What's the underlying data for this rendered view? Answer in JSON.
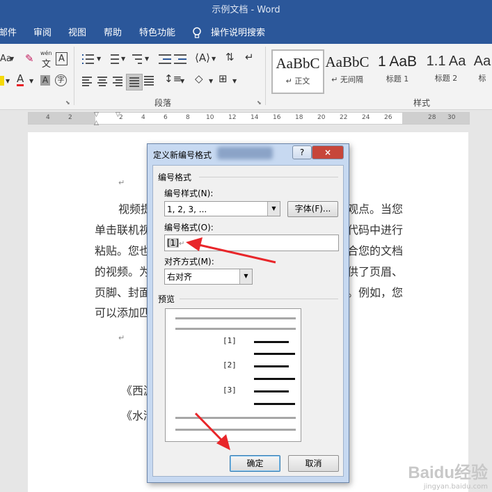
{
  "window": {
    "title": "示例文档 - Word"
  },
  "menubar": {
    "items": [
      "邮件",
      "审阅",
      "视图",
      "帮助",
      "特色功能"
    ],
    "tell_me": "操作说明搜索"
  },
  "ribbon": {
    "group_paragraph": "段落",
    "group_styles": "样式",
    "font_aa": "Aa",
    "phonetic_top": "wén",
    "phonetic_bottom": "文",
    "boxed_a": "A",
    "char_a": "A",
    "shaded_a": "A",
    "enclosed_char": "字",
    "styles": [
      {
        "sample": "AaBbC",
        "name": "↵ 正文"
      },
      {
        "sample": "AaBbC",
        "name": "↵ 无间隔"
      },
      {
        "sample": "1 AaB",
        "name": "标题 1"
      },
      {
        "sample": "1.1 Aa",
        "name": "标题 2"
      },
      {
        "sample": "Aa",
        "name": "标"
      }
    ]
  },
  "ruler": {
    "marks": [
      "4",
      "2",
      "2",
      "4",
      "6",
      "8",
      "10",
      "12",
      "14",
      "16",
      "18",
      "20",
      "22",
      "24",
      "26",
      "28",
      "30"
    ]
  },
  "document": {
    "para_mark": "↵",
    "lines": [
      "视频提",
      "单击联机视",
      "粘贴。您也",
      "的视频。为",
      "页脚、封面",
      "可以添加匹"
    ],
    "right_lines": [
      "观点。当您",
      "代码中进行",
      "合您的文档",
      "供了页眉、",
      "。例如，您"
    ],
    "bottom_lines": [
      "《西游",
      "《水浒"
    ]
  },
  "dialog": {
    "title": "定义新编号格式",
    "help": "?",
    "close": "×",
    "section_number_format": "编号格式",
    "number_style_label": "编号样式(N):",
    "number_style_value": "1, 2, 3, ...",
    "font_button": "字体(F)...",
    "number_format_label": "编号格式(O):",
    "number_format_value": "[1]",
    "alignment_label": "对齐方式(M):",
    "alignment_value": "右对齐",
    "section_preview": "预览",
    "preview_numbers": [
      "[1]",
      "[2]",
      "[3]"
    ],
    "ok": "确定",
    "cancel": "取消"
  },
  "watermark": {
    "brand": "Baidu经验",
    "url": "jingyan.baidu.com"
  },
  "colors": {
    "title_bar": "#2b579a",
    "annotation_arrow": "#e8262a",
    "dialog_frame": "#c7d9f1"
  }
}
